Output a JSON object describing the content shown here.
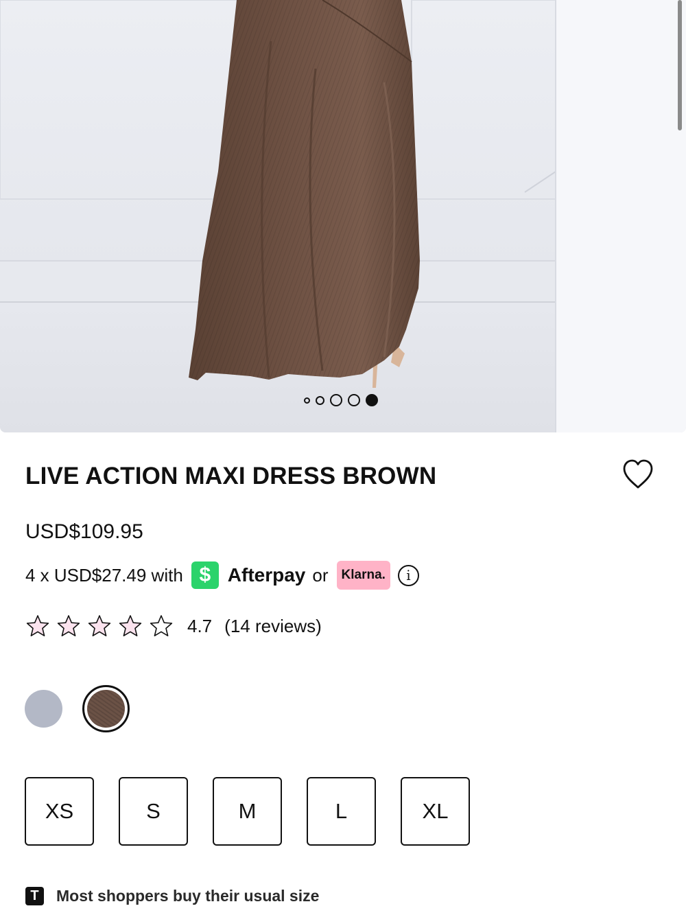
{
  "product": {
    "image_alt": "Model wearing brown satin maxi dress",
    "carousel": {
      "total": 5,
      "active": 5
    },
    "title": "LIVE ACTION MAXI DRESS BROWN",
    "price": "USD$109.95"
  },
  "payment": {
    "installment_text": "4 x USD$27.49 with",
    "afterpay_symbol": "$",
    "afterpay_label": "Afterpay",
    "or_text": "or",
    "klarna_label": "Klarna.",
    "info_symbol": "i"
  },
  "rating": {
    "value": "4.7",
    "reviews": "(14 reviews)",
    "filled_star_color": "#fbe3ee"
  },
  "colors": [
    {
      "name": "grey",
      "hex": "#b3b8c6",
      "selected": false
    },
    {
      "name": "brown",
      "hex": "#6b5246",
      "selected": true
    }
  ],
  "sizes": [
    "XS",
    "S",
    "M",
    "L",
    "XL"
  ],
  "fit": {
    "icon_letter": "T",
    "text": "Most shoppers buy their usual size"
  }
}
